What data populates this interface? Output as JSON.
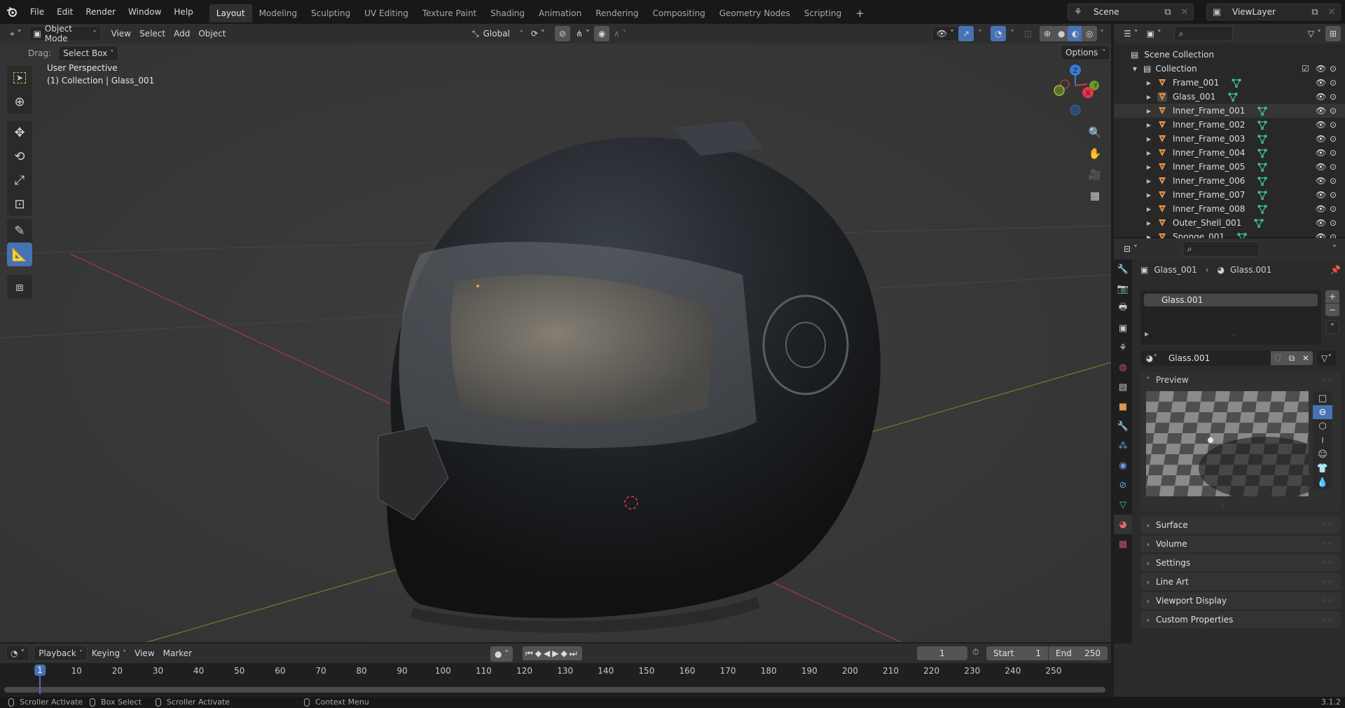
{
  "topbar": {
    "menus": [
      "File",
      "Edit",
      "Render",
      "Window",
      "Help"
    ],
    "workspaces": [
      "Layout",
      "Modeling",
      "Sculpting",
      "UV Editing",
      "Texture Paint",
      "Shading",
      "Animation",
      "Rendering",
      "Compositing",
      "Geometry Nodes",
      "Scripting"
    ],
    "active_workspace": "Layout",
    "add_workspace": "+",
    "scene": "Scene",
    "view_layer": "ViewLayer"
  },
  "viewport_header": {
    "mode": "Object Mode",
    "menus": [
      "View",
      "Select",
      "Add",
      "Object"
    ],
    "orientation": "Global",
    "options": "Options"
  },
  "tool_settings": {
    "drag_label": "Drag:",
    "drag_value": "Select Box"
  },
  "viewport": {
    "perspective": "User Perspective",
    "context": "(1) Collection | Glass_001",
    "gizmo": {
      "z": "Z",
      "y": "Y",
      "x": "X"
    }
  },
  "toolbar": {
    "tools": [
      "select-box",
      "cursor",
      "move",
      "rotate",
      "scale",
      "transform",
      "annotate",
      "measure",
      "add-cube"
    ],
    "active_tool": "measure"
  },
  "outliner": {
    "scene_collection": "Scene Collection",
    "collection": "Collection",
    "objects": [
      {
        "name": "Frame_001"
      },
      {
        "name": "Glass_001",
        "active": true
      },
      {
        "name": "Inner_Frame_001",
        "hover": true
      },
      {
        "name": "Inner_Frame_002"
      },
      {
        "name": "Inner_Frame_003"
      },
      {
        "name": "Inner_Frame_004"
      },
      {
        "name": "Inner_Frame_005"
      },
      {
        "name": "Inner_Frame_006"
      },
      {
        "name": "Inner_Frame_007"
      },
      {
        "name": "Inner_Frame_008"
      },
      {
        "name": "Outer_Shell_001"
      },
      {
        "name": "Sponge_001"
      }
    ]
  },
  "properties": {
    "breadcrumb_object": "Glass_001",
    "breadcrumb_material": "Glass.001",
    "slots": [
      "Glass.001"
    ],
    "material_name": "Glass.001",
    "preview_label": "Preview",
    "panels": [
      "Surface",
      "Volume",
      "Settings",
      "Line Art",
      "Viewport Display",
      "Custom Properties"
    ]
  },
  "timeline": {
    "menus": [
      "Playback",
      "Keying",
      "View",
      "Marker"
    ],
    "current_frame": "1",
    "start_label": "Start",
    "start": "1",
    "end_label": "End",
    "end": "250",
    "ticks": [
      "10",
      "20",
      "30",
      "40",
      "50",
      "60",
      "70",
      "80",
      "90",
      "100",
      "110",
      "120",
      "130",
      "140",
      "150",
      "160",
      "170",
      "180",
      "190",
      "200",
      "210",
      "220",
      "230",
      "240",
      "250"
    ],
    "playhead": "1"
  },
  "statusbar": {
    "items": [
      "Scroller Activate",
      "Box Select",
      "Scroller Activate",
      "Context Menu"
    ],
    "version": "3.1.2"
  },
  "colors": {
    "accent_blue": "#4772b3",
    "object_orange": "#e8984e",
    "mesh_green": "#3dc497",
    "axis_red": "#e0364d",
    "axis_green": "#7ba628"
  }
}
